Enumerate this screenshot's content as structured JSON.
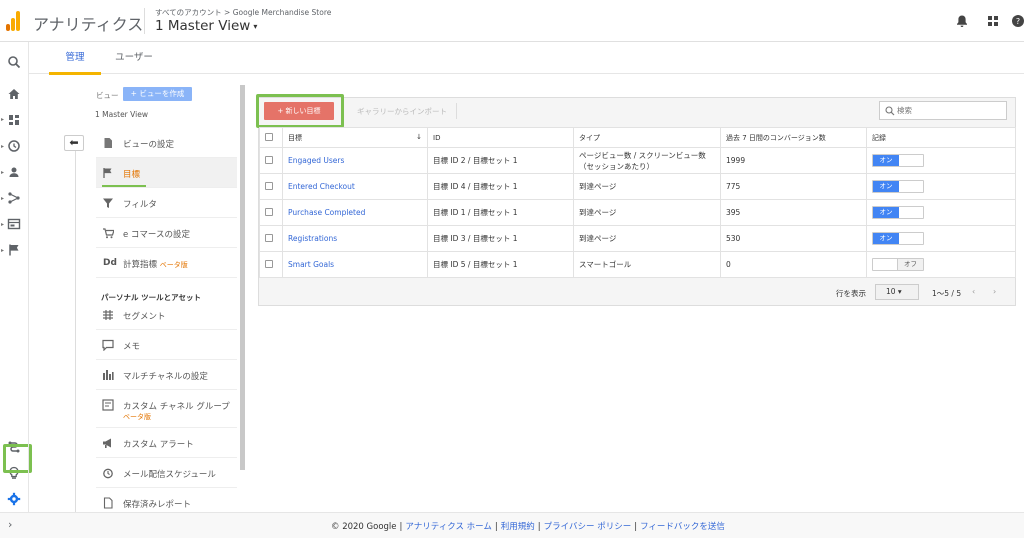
{
  "header": {
    "app_name": "アナリティクス",
    "breadcrumb": "すべてのアカウント > Google Merchandise Store",
    "view_name": "1 Master View",
    "caret": "▾"
  },
  "tabs": [
    {
      "label": "管理",
      "active": true
    },
    {
      "label": "ユーザー",
      "active": false
    }
  ],
  "view_column": {
    "label": "ビュー",
    "create_button": "+ ビューを作成",
    "selected_view": "1 Master View",
    "items": [
      {
        "label": "ビューの設定",
        "icon": "document-icon",
        "active": false
      },
      {
        "label": "目標",
        "icon": "flag-icon",
        "active": true
      },
      {
        "label": "フィルタ",
        "icon": "filter-icon",
        "active": false
      },
      {
        "label": "e コマースの設定",
        "icon": "cart-icon",
        "active": false
      },
      {
        "label": "計算指標",
        "icon": "dd-icon",
        "active": false,
        "beta": "ベータ版"
      }
    ],
    "section_title": "パーソナル ツールとアセット",
    "personal_items": [
      {
        "label": "セグメント",
        "icon": "segment-icon"
      },
      {
        "label": "メモ",
        "icon": "note-icon"
      },
      {
        "label": "マルチチャネルの設定",
        "icon": "bar-chart-icon"
      },
      {
        "label": "カスタム チャネル グループ",
        "icon": "channel-group-icon",
        "beta": "ベータ版"
      },
      {
        "label": "カスタム アラート",
        "icon": "megaphone-icon"
      },
      {
        "label": "メール配信スケジュール",
        "icon": "alarm-icon"
      },
      {
        "label": "保存済みレポート",
        "icon": "saved-report-icon"
      }
    ]
  },
  "goals": {
    "new_goal_button": "+ 新しい目標",
    "import_button": "ギャラリーからインポート",
    "search_placeholder": "検索",
    "columns": [
      "目標",
      "ID",
      "タイプ",
      "過去 7 日間のコンバージョン数",
      "記録"
    ],
    "sort_indicator": "↓",
    "rows": [
      {
        "name": "Engaged Users",
        "id": "目標 ID 2 / 目標セット 1",
        "type": "ページビュー数 / スクリーンビュー数（セッションあたり）",
        "conversions": "1999",
        "recording": "オン",
        "on": true
      },
      {
        "name": "Entered Checkout",
        "id": "目標 ID 4 / 目標セット 1",
        "type": "到達ページ",
        "conversions": "775",
        "recording": "オン",
        "on": true
      },
      {
        "name": "Purchase Completed",
        "id": "目標 ID 1 / 目標セット 1",
        "type": "到達ページ",
        "conversions": "395",
        "recording": "オン",
        "on": true
      },
      {
        "name": "Registrations",
        "id": "目標 ID 3 / 目標セット 1",
        "type": "到達ページ",
        "conversions": "530",
        "recording": "オン",
        "on": true
      },
      {
        "name": "Smart Goals",
        "id": "目標 ID 5 / 目標セット 1",
        "type": "スマートゴール",
        "conversions": "0",
        "recording": "オフ",
        "on": false
      }
    ],
    "pager": {
      "rows_label": "行を表示",
      "rows_value": "10 ▾",
      "range": "1～5 / 5",
      "prev": "‹",
      "next": "›"
    }
  },
  "footer": {
    "copyright": "© 2020 Google",
    "links": [
      "アナリティクス ホーム",
      "利用規約",
      "プライバシー ポリシー",
      "フィードバックを送信"
    ],
    "expand": "›"
  },
  "colors": {
    "accent": "#4285f4",
    "highlight": "#7cc050",
    "new_goal": "#e57368",
    "tab_underline": "#f4b400"
  }
}
